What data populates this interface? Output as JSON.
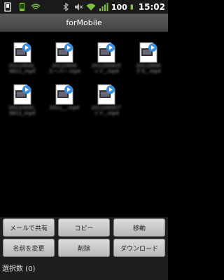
{
  "statusbar": {
    "battery": "100",
    "time": "15:02"
  },
  "app": {
    "title": "forMobile"
  },
  "files": [
    {
      "name": "20110930_\n6611_mp4"
    },
    {
      "name": "20110930\nスーパー.mp4"
    },
    {
      "name": "20110930ガ\nイド_.mp4"
    },
    {
      "name": "20110930\nデモ_.mp4"
    },
    {
      "name": "20110930_\n6611_mp4"
    },
    {
      "name": "2011__.mp4\n"
    },
    {
      "name": "20110930ア\nイド_.mp4"
    }
  ],
  "actions": {
    "share_mail": "メールで共有",
    "copy": "コピー",
    "move": "移動",
    "rename": "名前を変更",
    "delete": "削除",
    "download": "ダウンロード"
  },
  "selection": {
    "label": "選択数 (0)"
  }
}
